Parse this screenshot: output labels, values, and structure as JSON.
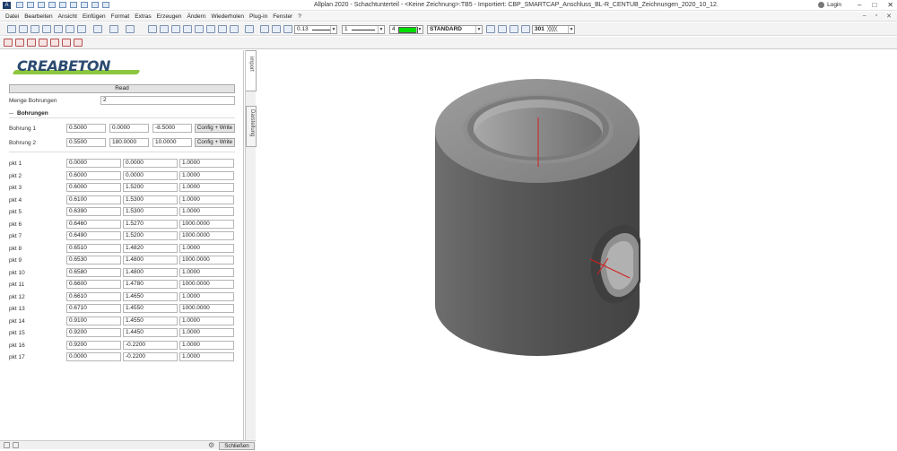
{
  "window": {
    "title": "Allplan 2020 - Schachtunterteil - <Keine Zeichnung>:TB5 - Importiert: CBP_SMARTCAP_Anschluss_BL-R_CENTUB_Zeichnungen_2020_10_12.",
    "login_label": "Login"
  },
  "menu": [
    "Datei",
    "Bearbeiten",
    "Ansicht",
    "Einfügen",
    "Format",
    "Extras",
    "Erzeugen",
    "Ändern",
    "Wiederholen",
    "Plug-in",
    "Fenster",
    "?"
  ],
  "toolbar": {
    "pen_thickness": "0.13",
    "line_type": "1",
    "color_number": "4",
    "color_hex": "#00dd00",
    "layer": "STANDARD",
    "pattern_number": "301"
  },
  "panel": {
    "brand": "CREABETON",
    "read_label": "Read",
    "menge_label": "Menge Bohrungen",
    "menge_value": "2",
    "section_label": "Bohrungen",
    "bohrungen": [
      {
        "label": "Bohrung 1",
        "values": [
          "0.5000",
          "0.0000",
          "-8.5000"
        ],
        "button": "Config + Write"
      },
      {
        "label": "Bohrung 2",
        "values": [
          "0.5500",
          "180.0000",
          "10.0000"
        ],
        "button": "Config + Write"
      }
    ],
    "points": [
      {
        "label": "pkt 1",
        "values": [
          "0.0000",
          "0.0000",
          "1.0000"
        ]
      },
      {
        "label": "pkt 2",
        "values": [
          "0.6000",
          "0.0000",
          "1.0000"
        ]
      },
      {
        "label": "pkt 3",
        "values": [
          "0.6000",
          "1.5200",
          "1.0000"
        ]
      },
      {
        "label": "pkt 4",
        "values": [
          "0.6100",
          "1.5300",
          "1.0000"
        ]
      },
      {
        "label": "pkt 5",
        "values": [
          "0.6390",
          "1.5300",
          "1.0000"
        ]
      },
      {
        "label": "pkt 6",
        "values": [
          "0.6460",
          "1.5270",
          "1000.0000"
        ]
      },
      {
        "label": "pkt 7",
        "values": [
          "0.6490",
          "1.5200",
          "1000.0000"
        ]
      },
      {
        "label": "pkt 8",
        "values": [
          "0.6510",
          "1.4820",
          "1.0000"
        ]
      },
      {
        "label": "pkt 9",
        "values": [
          "0.6530",
          "1.4800",
          "1000.0000"
        ]
      },
      {
        "label": "pkt 10",
        "values": [
          "0.6580",
          "1.4800",
          "1.0000"
        ]
      },
      {
        "label": "pkt 11",
        "values": [
          "0.6600",
          "1.4780",
          "1000.0000"
        ]
      },
      {
        "label": "pkt 12",
        "values": [
          "0.6610",
          "1.4650",
          "1.0000"
        ]
      },
      {
        "label": "pkt 13",
        "values": [
          "0.6710",
          "1.4550",
          "1000.0000"
        ]
      },
      {
        "label": "pkt 14",
        "values": [
          "0.9100",
          "1.4550",
          "1.0000"
        ]
      },
      {
        "label": "pkt 15",
        "values": [
          "0.9200",
          "1.4450",
          "1.0000"
        ]
      },
      {
        "label": "pkt 16",
        "values": [
          "0.9200",
          "-0.2200",
          "1.0000"
        ]
      },
      {
        "label": "pkt 17",
        "values": [
          "0.0000",
          "-0.2200",
          "1.0000"
        ]
      }
    ],
    "close_label": "Schließen"
  },
  "side_tabs": [
    "import",
    "Darstellung"
  ]
}
